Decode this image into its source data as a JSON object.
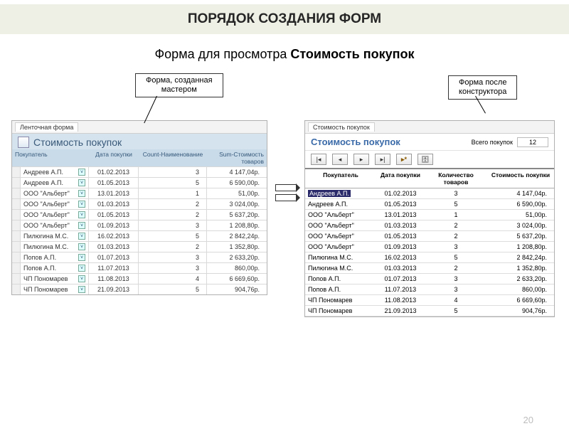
{
  "slide": {
    "banner_title": "ПОРЯДОК СОЗДАНИЯ ФОРМ",
    "subtitle_lead": "Форма для просмотра ",
    "subtitle_strong": "Стоимость покупок",
    "label_left_l1": "Форма, созданная",
    "label_left_l2": "мастером",
    "label_right_l1": "Форма после",
    "label_right_l2": "конструктора",
    "page_number": "20"
  },
  "left_form": {
    "tab": "Ленточная форма",
    "title": "Стоимость покупок",
    "columns": {
      "c1": "Покупатель",
      "c2": "Дата покупки",
      "c3": "Count-Наименование",
      "c4": "Sum-Стоимость товаров"
    },
    "rows": [
      {
        "buyer": "Андреев А.П.",
        "date": "01.02.2013",
        "cnt": "3",
        "sum": "4 147,04р."
      },
      {
        "buyer": "Андреев А.П.",
        "date": "01.05.2013",
        "cnt": "5",
        "sum": "6 590,00р."
      },
      {
        "buyer": "ООО \"Альберт\"",
        "date": "13.01.2013",
        "cnt": "1",
        "sum": "51,00р."
      },
      {
        "buyer": "ООО \"Альберт\"",
        "date": "01.03.2013",
        "cnt": "2",
        "sum": "3 024,00р."
      },
      {
        "buyer": "ООО \"Альберт\"",
        "date": "01.05.2013",
        "cnt": "2",
        "sum": "5 637,20р."
      },
      {
        "buyer": "ООО \"Альберт\"",
        "date": "01.09.2013",
        "cnt": "3",
        "sum": "1 208,80р."
      },
      {
        "buyer": "Пилюгина М.С.",
        "date": "16.02.2013",
        "cnt": "5",
        "sum": "2 842,24р."
      },
      {
        "buyer": "Пилюгина М.С.",
        "date": "01.03.2013",
        "cnt": "2",
        "sum": "1 352,80р."
      },
      {
        "buyer": "Попов А.П.",
        "date": "01.07.2013",
        "cnt": "3",
        "sum": "2 633,20р."
      },
      {
        "buyer": "Попов А.П.",
        "date": "11.07.2013",
        "cnt": "3",
        "sum": "860,00р."
      },
      {
        "buyer": "ЧП Пономарев",
        "date": "11.08.2013",
        "cnt": "4",
        "sum": "6 669,60р."
      },
      {
        "buyer": "ЧП Пономарев",
        "date": "21.09.2013",
        "cnt": "5",
        "sum": "904,76р."
      }
    ],
    "dropdown_glyph": "˅"
  },
  "right_form": {
    "tab": "Стоимость покупок",
    "title": "Стоимость покупок",
    "total_label": "Всего покупок",
    "total_value": "12",
    "nav": {
      "first": "|◂",
      "prev": "◂",
      "next": "▸",
      "last": "▸|",
      "new": "▸*",
      "filter": "🗄"
    },
    "columns": {
      "c1": "Покупатель",
      "c2": "Дата покупки",
      "c3": "Количество товаров",
      "c4": "Стоимость покупки"
    },
    "rows": [
      {
        "buyer": "Андреев А.П.",
        "date": "01.02.2013",
        "cnt": "3",
        "sum": "4 147,04р.",
        "hl": true
      },
      {
        "buyer": "Андреев А.П.",
        "date": "01.05.2013",
        "cnt": "5",
        "sum": "6 590,00р."
      },
      {
        "buyer": "ООО \"Альберт\"",
        "date": "13.01.2013",
        "cnt": "1",
        "sum": "51,00р."
      },
      {
        "buyer": "ООО \"Альберт\"",
        "date": "01.03.2013",
        "cnt": "2",
        "sum": "3 024,00р."
      },
      {
        "buyer": "ООО \"Альберт\"",
        "date": "01.05.2013",
        "cnt": "2",
        "sum": "5 637,20р."
      },
      {
        "buyer": "ООО \"Альберт\"",
        "date": "01.09.2013",
        "cnt": "3",
        "sum": "1 208,80р."
      },
      {
        "buyer": "Пилюгина М.С.",
        "date": "16.02.2013",
        "cnt": "5",
        "sum": "2 842,24р."
      },
      {
        "buyer": "Пилюгина М.С.",
        "date": "01.03.2013",
        "cnt": "2",
        "sum": "1 352,80р."
      },
      {
        "buyer": "Попов А.П.",
        "date": "01.07.2013",
        "cnt": "3",
        "sum": "2 633,20р."
      },
      {
        "buyer": "Попов А.П.",
        "date": "11.07.2013",
        "cnt": "3",
        "sum": "860,00р."
      },
      {
        "buyer": "ЧП Пономарев",
        "date": "11.08.2013",
        "cnt": "4",
        "sum": "6 669,60р."
      },
      {
        "buyer": "ЧП Пономарев",
        "date": "21.09.2013",
        "cnt": "5",
        "sum": "904,76р."
      }
    ]
  }
}
